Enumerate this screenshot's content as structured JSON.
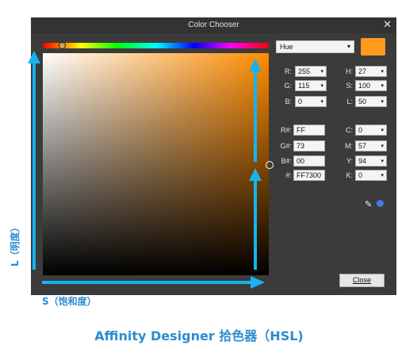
{
  "window": {
    "title": "Color Chooser",
    "close_glyph": "✕"
  },
  "hue_slider": {
    "value_deg": 27
  },
  "mode_select": {
    "value": "Hue",
    "caret": "▾"
  },
  "swatch": {
    "color": "#ff9a1f"
  },
  "rgb": [
    {
      "label": "R:",
      "value": "255"
    },
    {
      "label": "G:",
      "value": "115"
    },
    {
      "label": "B:",
      "value": "0"
    }
  ],
  "hsl": [
    {
      "label": "H:",
      "value": "27"
    },
    {
      "label": "S:",
      "value": "100"
    },
    {
      "label": "L:",
      "value": "50"
    }
  ],
  "hex_channels": [
    {
      "label": "R#:",
      "value": "FF"
    },
    {
      "label": "G#:",
      "value": "73"
    },
    {
      "label": "B#:",
      "value": "00"
    },
    {
      "label": "#:",
      "value": "FF7300"
    }
  ],
  "cmyk": [
    {
      "label": "C:",
      "value": "0"
    },
    {
      "label": "M:",
      "value": "57"
    },
    {
      "label": "Y:",
      "value": "94"
    },
    {
      "label": "K:",
      "value": "0"
    }
  ],
  "close_button": "Close",
  "annotations": {
    "l_label": "L（明度）",
    "s_label": "S（饱和度）",
    "caption": "Affinity Designer 拾色器（HSL)"
  },
  "colors": {
    "accent_arrow": "#17b3ef",
    "caption_blue": "#2c8ccf",
    "dialog_bg": "#3b3b3b"
  }
}
